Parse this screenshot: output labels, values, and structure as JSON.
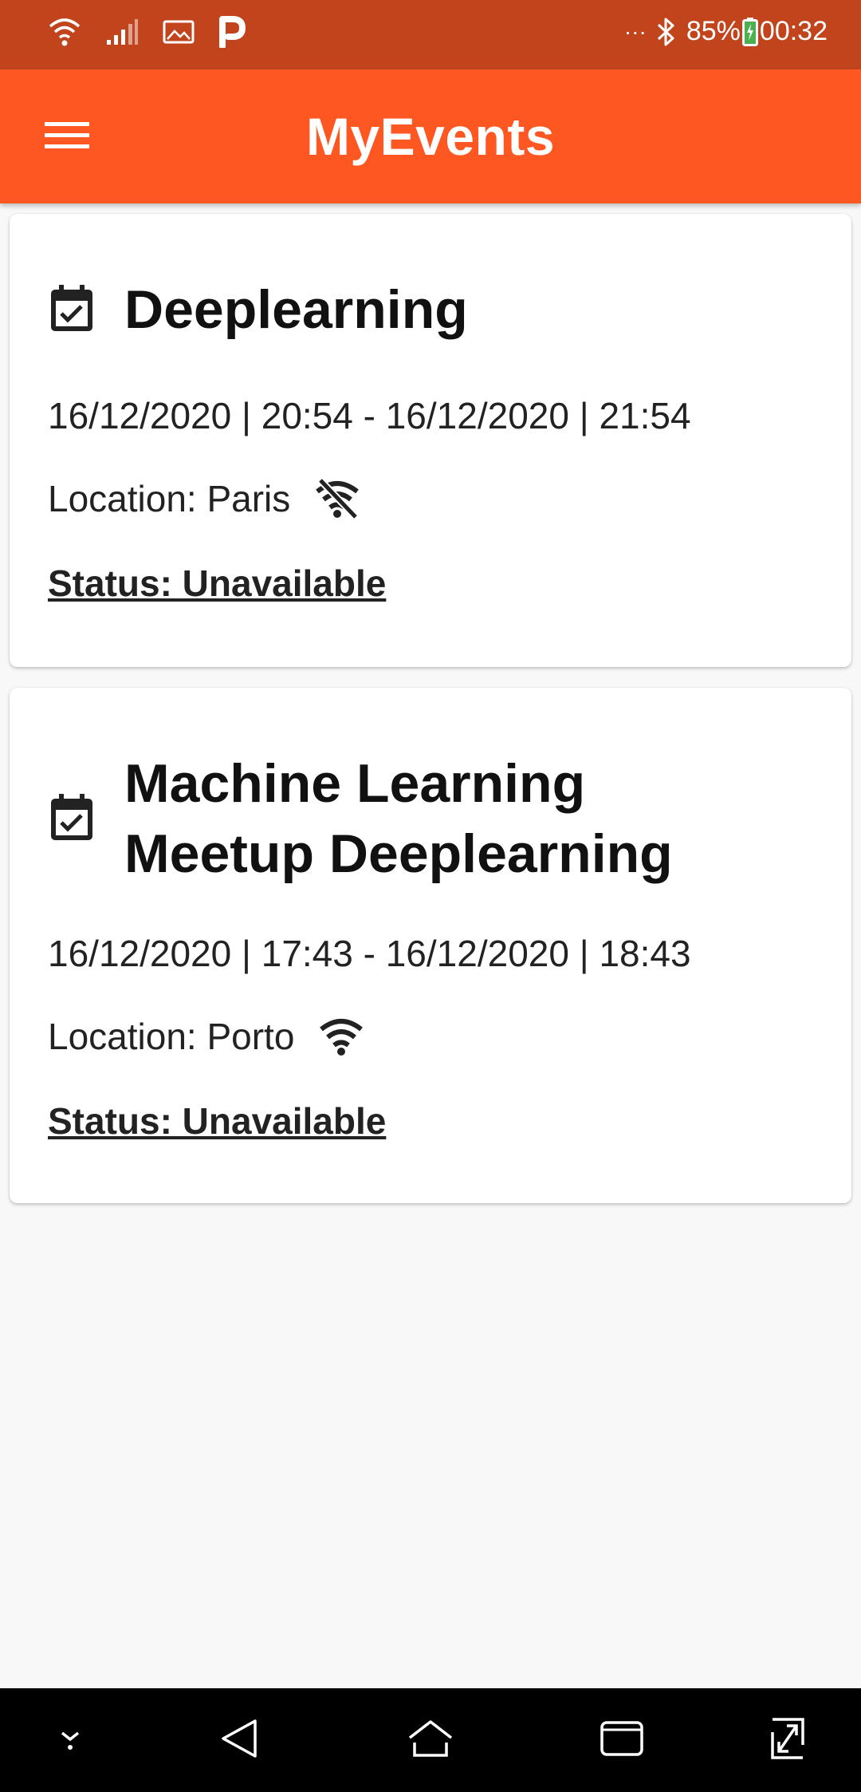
{
  "status_bar": {
    "icons": [
      "wifi-icon",
      "signal-icon",
      "image-icon",
      "p-icon",
      "more-icon",
      "bluetooth-icon",
      "battery-icon"
    ],
    "overflow": "···",
    "battery": "85%",
    "time": "00:32"
  },
  "app_bar": {
    "title": "MyEvents",
    "menu_icon": "hamburger-menu-icon"
  },
  "events": [
    {
      "title": "Deeplearning",
      "dates": "16/12/2020 | 20:54 - 16/12/2020 | 21:54",
      "location": "Location: Paris",
      "location_icon": "wifi-off-icon",
      "status": "Status: Unavailable "
    },
    {
      "title": "Machine Learning Meetup Deeplearning",
      "dates": "16/12/2020 | 17:43 - 16/12/2020 | 18:43",
      "location": "Location: Porto",
      "location_icon": "wifi-icon",
      "status": "Status: Unavailable "
    }
  ],
  "nav_bar": {
    "buttons": [
      "collapse-icon",
      "back-icon",
      "home-icon",
      "recents-icon",
      "screenshot-icon"
    ]
  },
  "colors": {
    "status_bar": "#c1441d",
    "app_bar": "#ff5722",
    "background": "#f8f8f8"
  }
}
